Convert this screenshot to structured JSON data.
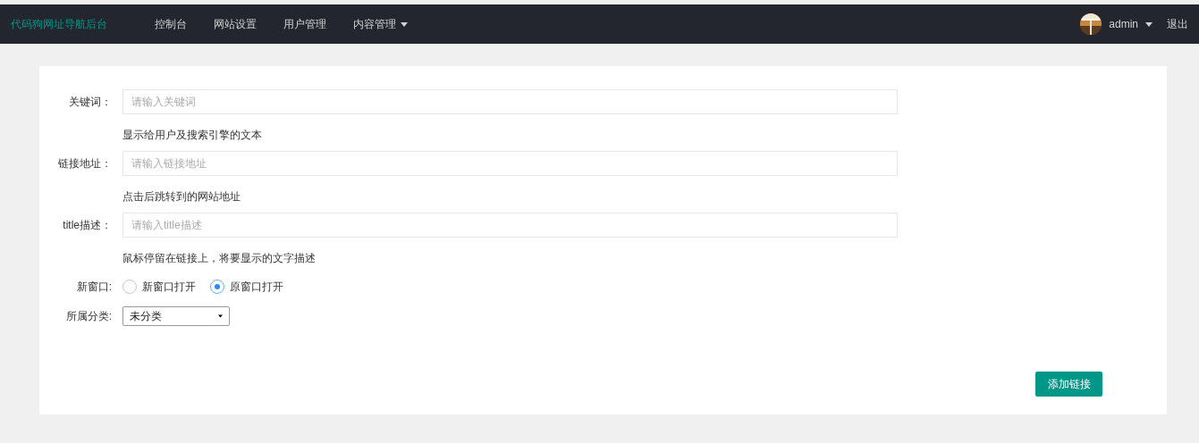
{
  "navbar": {
    "brand": "代码狗网址导航后台",
    "menu": [
      {
        "label": "控制台",
        "dropdown": false
      },
      {
        "label": "网站设置",
        "dropdown": false
      },
      {
        "label": "用户管理",
        "dropdown": false
      },
      {
        "label": "内容管理",
        "dropdown": true
      }
    ],
    "user": {
      "name": "admin"
    },
    "logout": "退出"
  },
  "form": {
    "fields": [
      {
        "kind": "text",
        "label": "关键词：",
        "placeholder": "请输入关键词",
        "help": "显示给用户及搜索引擎的文本"
      },
      {
        "kind": "text",
        "label": "链接地址：",
        "placeholder": "请输入链接地址",
        "help": "点击后跳转到的网站地址"
      },
      {
        "kind": "text",
        "label": "title描述：",
        "placeholder": "请输入title描述",
        "help": "鼠标停留在链接上，将要显示的文字描述"
      },
      {
        "kind": "radio",
        "label": "新窗口:",
        "options": [
          {
            "label": "新窗口打开",
            "selected": false
          },
          {
            "label": "原窗口打开",
            "selected": true
          }
        ]
      },
      {
        "kind": "select",
        "label": "所属分类:",
        "value": "未分类"
      }
    ],
    "submit": "添加链接"
  }
}
